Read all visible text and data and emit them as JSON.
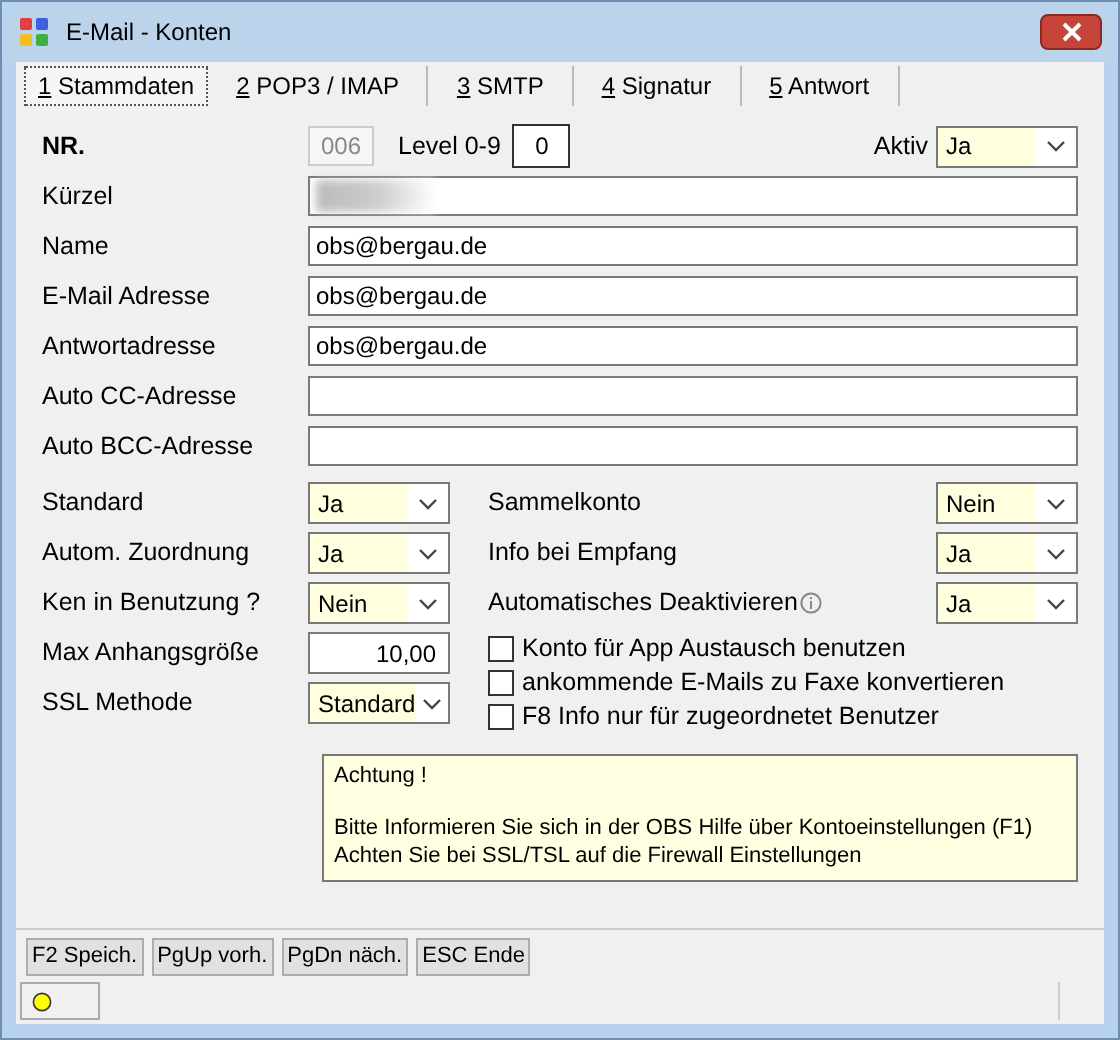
{
  "window": {
    "title": "E-Mail - Konten"
  },
  "tabs": [
    {
      "hotkey": "1",
      "label": "Stammdaten",
      "selected": true
    },
    {
      "hotkey": "2",
      "label": "POP3 / IMAP",
      "selected": false
    },
    {
      "hotkey": "3",
      "label": "SMTP",
      "selected": false
    },
    {
      "hotkey": "4",
      "label": "Signatur",
      "selected": false
    },
    {
      "hotkey": "5",
      "label": "Antwort",
      "selected": false
    }
  ],
  "header": {
    "nr_label": "NR.",
    "nr_value": "006",
    "level_label": "Level 0-9",
    "level_value": "0",
    "active_label": "Aktiv",
    "active_value": "Ja"
  },
  "fields": [
    {
      "label": "Kürzel",
      "redacted": true
    },
    {
      "label": "Name",
      "value": "obs@bergau.de"
    },
    {
      "label": "E-Mail Adresse",
      "value": "obs@bergau.de"
    },
    {
      "label": "Antwortadresse",
      "value": "obs@bergau.de"
    },
    {
      "label": "Auto CC-Adresse"
    },
    {
      "label": "Auto BCC-Adresse"
    }
  ],
  "left_options": [
    {
      "label": "Standard",
      "kind": "select",
      "value": "Ja"
    },
    {
      "label": "Autom. Zuordnung",
      "kind": "select",
      "value": "Ja"
    },
    {
      "label": "Ken in Benutzung ?",
      "kind": "select",
      "value": "Nein"
    },
    {
      "label": "Max Anhangsgröße",
      "kind": "number",
      "value": "10,00"
    },
    {
      "label": "SSL Methode",
      "kind": "select",
      "value": "Standard"
    }
  ],
  "right_options": [
    {
      "label": "Sammelkonto",
      "info": false,
      "value": "Nein"
    },
    {
      "label": "Info bei Empfang",
      "info": false,
      "value": "Ja"
    },
    {
      "label": "Automatisches Deaktivieren",
      "info": true,
      "value": "Ja"
    }
  ],
  "checkboxes": [
    {
      "label": "Konto für App Austausch benutzen",
      "checked": false
    },
    {
      "label": "ankommende E-Mails zu Faxe konvertieren",
      "checked": false
    },
    {
      "label": "F8 Info nur für zugeordnetet Benutzer",
      "checked": false
    }
  ],
  "notice": {
    "title": "Achtung !",
    "lines": [
      "Bitte Informieren Sie sich in der OBS Hilfe über Kontoeinstellungen (F1)",
      "Achten Sie bei SSL/TSL auf die Firewall Einstellungen"
    ]
  },
  "buttons": [
    "F2 Speich.",
    "PgUp vorh.",
    "PgDn näch.",
    "ESC Ende"
  ]
}
